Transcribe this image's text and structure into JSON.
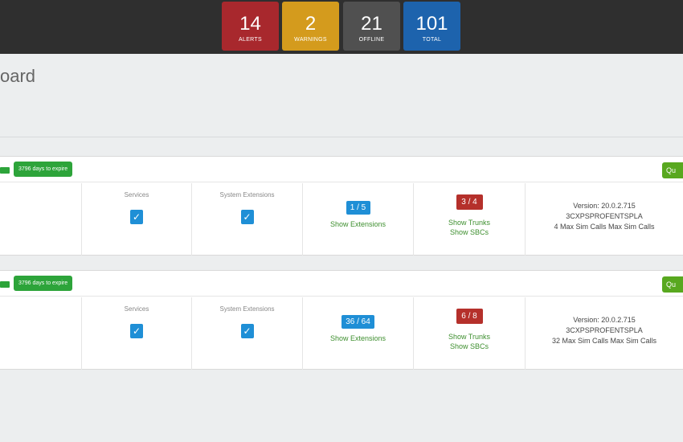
{
  "header": {
    "stats": [
      {
        "value": "14",
        "label": "ALERTS",
        "color": "#a8282d"
      },
      {
        "value": "2",
        "label": "WARNINGS",
        "color": "#d49b1d"
      },
      {
        "value": "21",
        "label": "OFFLINE",
        "color": "#505050"
      },
      {
        "value": "101",
        "label": "TOTAL",
        "color": "#1d63ad"
      }
    ]
  },
  "page": {
    "title": "oard"
  },
  "cards": [
    {
      "expiry": "3796 days to expire",
      "edge_button": "Qu",
      "services_label": "Services",
      "system_extensions_label": "System Extensions",
      "check_icon": "✓",
      "extensions_badge": "1 / 5",
      "show_extensions": "Show Extensions",
      "trunks_badge": "3 / 4",
      "show_trunks": "Show Trunks",
      "show_sbcs": "Show SBCs",
      "version": "Version: 20.0.2.715",
      "edition": "3CXPSPROFENTSPLA",
      "sim_calls": "4 Max Sim Calls Max Sim Calls"
    },
    {
      "expiry": "3796 days to expire",
      "edge_button": "Qu",
      "services_label": "Services",
      "system_extensions_label": "System Extensions",
      "check_icon": "✓",
      "extensions_badge": "36 / 64",
      "show_extensions": "Show Extensions",
      "trunks_badge": "6 / 8",
      "show_trunks": "Show Trunks",
      "show_sbcs": "Show SBCs",
      "version": "Version: 20.0.2.715",
      "edition": "3CXPSPROFENTSPLA",
      "sim_calls": "32 Max Sim Calls Max Sim Calls"
    }
  ],
  "colors": {
    "accent_green": "#2da43a",
    "link_green": "#3e8f2f",
    "badge_blue": "#1f8fd6",
    "badge_red": "#b5302b"
  }
}
